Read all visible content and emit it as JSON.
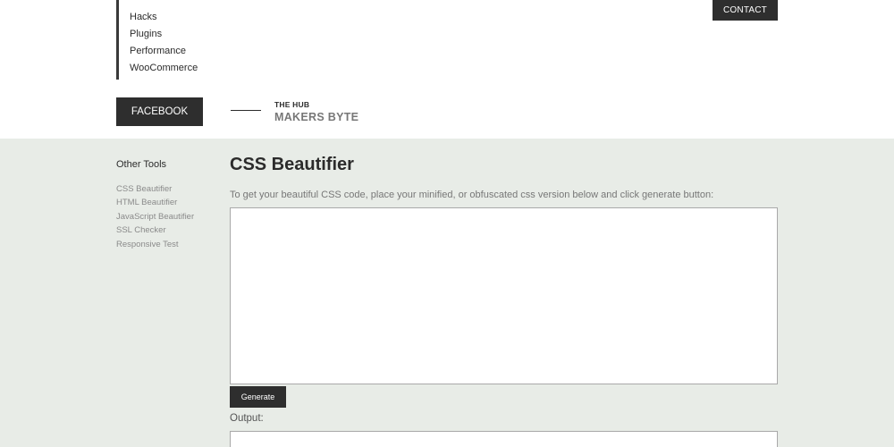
{
  "header": {
    "nav_items": [
      "Hacks",
      "Plugins",
      "Performance",
      "WooCommerce"
    ],
    "contact_label": "CONTACT",
    "facebook_label": "FACEBOOK",
    "hub_small": "THE HUB",
    "hub_big": "MAKERS BYTE"
  },
  "sidebar": {
    "title": "Other Tools",
    "items": [
      "CSS Beautifier",
      "HTML Beautifier",
      "JavaScript Beautifier",
      "SSL Checker",
      "Responsive Test"
    ]
  },
  "main": {
    "title": "CSS Beautifier",
    "instructions": "To get your beautiful CSS code, place your minified, or obfuscated css version below and click generate button:",
    "input_value": "",
    "generate_label": "Generate",
    "output_label": "Output:"
  },
  "colors": {
    "dark_button": "#2e2e2e",
    "main_background": "#e8ece7"
  }
}
